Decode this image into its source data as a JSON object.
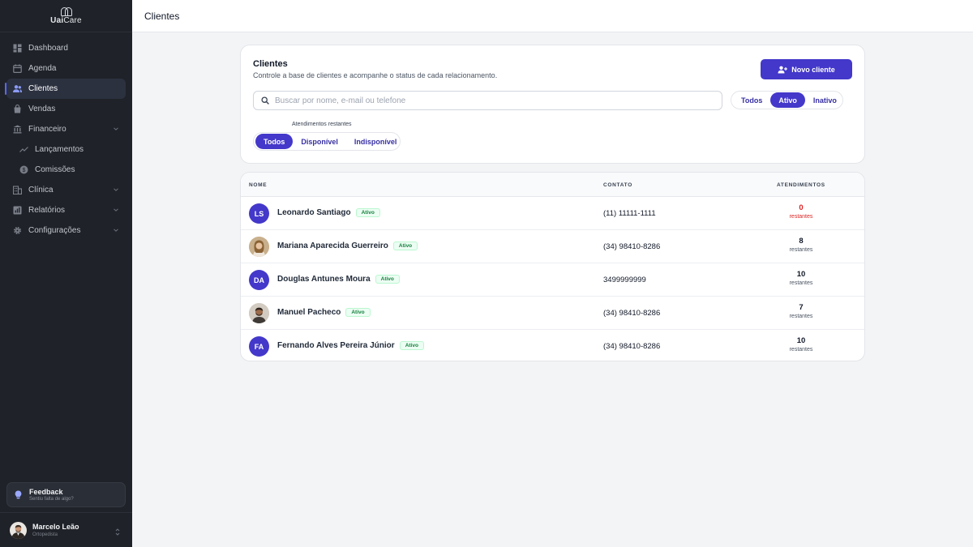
{
  "app": {
    "logo_bold": "Uai",
    "logo_light": "Care",
    "page_title": "Clientes"
  },
  "sidebar": {
    "items": [
      {
        "label": "Dashboard",
        "icon": "dashboard-icon"
      },
      {
        "label": "Agenda",
        "icon": "calendar-icon"
      },
      {
        "label": "Clientes",
        "icon": "users-icon",
        "active": true
      },
      {
        "label": "Vendas",
        "icon": "shopping-bag-icon"
      },
      {
        "label": "Financeiro",
        "icon": "bank-icon",
        "expanded": true
      },
      {
        "label": "Lançamentos",
        "icon": "trend-line-icon",
        "sub": true
      },
      {
        "label": "Comissões",
        "icon": "coin-icon",
        "sub": true
      },
      {
        "label": "Clínica",
        "icon": "building-icon"
      },
      {
        "label": "Relatórios",
        "icon": "report-icon"
      },
      {
        "label": "Configurações",
        "icon": "gear-icon"
      }
    ],
    "feedback": {
      "title": "Feedback",
      "subtitle": "Sentiu falta de algo?"
    },
    "user": {
      "name": "Marcelo Leão",
      "role": "Ortopedista"
    }
  },
  "header_card": {
    "title": "Clientes",
    "description": "Controle a base de clientes e acompanhe o status de cada relacionamento.",
    "new_button": "Novo cliente",
    "search_placeholder": "Buscar por nome, e-mail ou telefone",
    "status_filter": {
      "options": [
        "Todos",
        "Ativo",
        "Inativo"
      ],
      "selected": "Ativo"
    },
    "availability_filter": {
      "label": "Atendimentos restantes",
      "options": [
        "Todos",
        "Disponível",
        "Indisponível"
      ],
      "selected": "Todos"
    }
  },
  "table": {
    "columns": [
      "NOME",
      "CONTATO",
      "ATENDIMENTOS"
    ],
    "remaining_label": "restantes",
    "rows": [
      {
        "initials": "LS",
        "name": "Leonardo Santiago",
        "status": "Ativo",
        "contact": "(11) 11111-1111",
        "remaining": "0"
      },
      {
        "initials": "",
        "name": "Mariana Aparecida Guerreiro",
        "status": "Ativo",
        "contact": "(34) 98410-8286",
        "remaining": "8"
      },
      {
        "initials": "DA",
        "name": "Douglas Antunes Moura",
        "status": "Ativo",
        "contact": "3499999999",
        "remaining": "10"
      },
      {
        "initials": "",
        "name": "Manuel Pacheco",
        "status": "Ativo",
        "contact": "(34) 98410-8286",
        "remaining": "7"
      },
      {
        "initials": "FA",
        "name": "Fernando Alves Pereira Júnior",
        "status": "Ativo",
        "contact": "(34) 98410-8286",
        "remaining": "10"
      }
    ]
  },
  "colors": {
    "primary": "#4338ca",
    "sidebar_bg": "#1f2228",
    "status_green": "#15803d",
    "danger": "#dc2626"
  }
}
